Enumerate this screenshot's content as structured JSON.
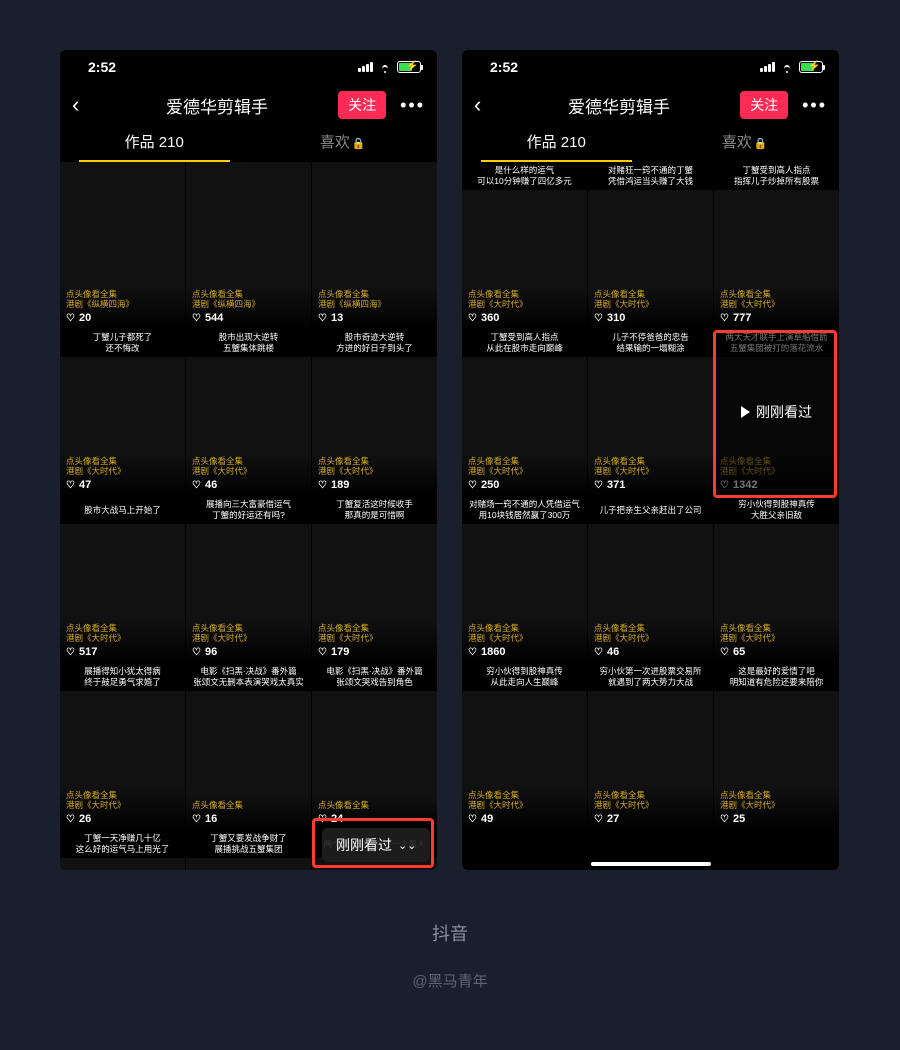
{
  "status_bar": {
    "time": "2:52"
  },
  "nav": {
    "title": "爱德华剪辑手",
    "follow_label": "关注",
    "more_label": "•••"
  },
  "tabs": {
    "works_label": "作品 210",
    "likes_label": "喜欢"
  },
  "just_watched": {
    "pill_label": "刚刚看过",
    "overlay_label": "刚刚看过"
  },
  "phone_left": {
    "cells": [
      {
        "title_l1": "",
        "title_l2": "",
        "series_l1": "点头像看全集",
        "series_l2": "港剧《纵横四海》",
        "likes": "20"
      },
      {
        "title_l1": "",
        "title_l2": "",
        "series_l1": "点头像看全集",
        "series_l2": "港剧《纵横四海》",
        "likes": "544"
      },
      {
        "title_l1": "",
        "title_l2": "",
        "series_l1": "点头像看全集",
        "series_l2": "港剧《纵横四海》",
        "likes": "13"
      },
      {
        "title_l1": "丁蟹儿子都死了",
        "title_l2": "还不悔改",
        "series_l1": "点头像看全集",
        "series_l2": "港剧《大时代》",
        "likes": "47"
      },
      {
        "title_l1": "股市出现大逆转",
        "title_l2": "五蟹集体跳楼",
        "series_l1": "点头像看全集",
        "series_l2": "港剧《大时代》",
        "likes": "46"
      },
      {
        "title_l1": "股市奇迹大逆转",
        "title_l2": "方进的好日子到头了",
        "series_l1": "点头像看全集",
        "series_l2": "港剧《大时代》",
        "likes": "189"
      },
      {
        "title_l1": "股市大战马上开始了",
        "title_l2": "",
        "series_l1": "点头像看全集",
        "series_l2": "港剧《大时代》",
        "likes": "517"
      },
      {
        "title_l1": "展播向三大富豪借运气",
        "title_l2": "丁蟹的好运还有吗?",
        "series_l1": "点头像看全集",
        "series_l2": "港剧《大时代》",
        "likes": "96"
      },
      {
        "title_l1": "丁蟹复活这时候收手",
        "title_l2": "那真的是可惜啊",
        "series_l1": "点头像看全集",
        "series_l2": "港剧《大时代》",
        "likes": "179"
      },
      {
        "title_l1": "展播得知小犹太得病",
        "title_l2": "终于鼓足勇气求婚了",
        "series_l1": "点头像看全集",
        "series_l2": "港剧《大时代》",
        "likes": "26"
      },
      {
        "title_l1": "电影《扫黑·决战》番外篇",
        "title_l2": "张颂文无删本表演哭戏太真实",
        "series_l1": "点头像看全集",
        "series_l2": "",
        "likes": "16"
      },
      {
        "title_l1": "电影《扫黑·决战》番外篇",
        "title_l2": "张颂文哭戏告别角色",
        "series_l1": "点头像看全集",
        "series_l2": "",
        "likes": "24"
      },
      {
        "title_l1": "丁蟹一天净赚几十亿",
        "title_l2": "这么好的运气马上用光了",
        "series_l1": "",
        "series_l2": "",
        "likes": ""
      },
      {
        "title_l1": "丁蟹又要发战争财了",
        "title_l2": "展播挑战五蟹集团",
        "series_l1": "",
        "series_l2": "",
        "likes": ""
      },
      {
        "title_l1": "两个女人同时喜欢一个男人",
        "title_l2": "",
        "series_l1": "",
        "series_l2": "",
        "likes": ""
      }
    ]
  },
  "phone_right": {
    "cells": [
      {
        "title_l1": "是什么样的运气",
        "title_l2": "可以10分钟赚了四亿多元",
        "series_l1": "点头像看全集",
        "series_l2": "港剧《大时代》",
        "likes": "360"
      },
      {
        "title_l1": "对赌狂一窍不通的丁蟹",
        "title_l2": "凭借鸿运当头赚了大钱",
        "series_l1": "点头像看全集",
        "series_l2": "港剧《大时代》",
        "likes": "310"
      },
      {
        "title_l1": "丁蟹受到高人指点",
        "title_l2": "指挥儿子炒掉所有股票",
        "series_l1": "点头像看全集",
        "series_l2": "港剧《大时代》",
        "likes": "777"
      },
      {
        "title_l1": "丁蟹受到高人指点",
        "title_l2": "从此在股市走向巅峰",
        "series_l1": "点头像看全集",
        "series_l2": "港剧《大时代》",
        "likes": "250"
      },
      {
        "title_l1": "儿子不停爸爸的忠告",
        "title_l2": "结果输的一塌糊涂",
        "series_l1": "点头像看全集",
        "series_l2": "港剧《大时代》",
        "likes": "371"
      },
      {
        "title_l1": "两大天才联手上演草船借箭",
        "title_l2": "五蟹集团被打的落花流水",
        "series_l1": "点头像看全集",
        "series_l2": "港剧《大时代》",
        "likes": "1342"
      },
      {
        "title_l1": "对赌场一窍不通的人凭借运气",
        "title_l2": "用10块钱居然赢了300万",
        "series_l1": "点头像看全集",
        "series_l2": "港剧《大时代》",
        "likes": "1860"
      },
      {
        "title_l1": "儿子把亲生父亲赶出了公司",
        "title_l2": "",
        "series_l1": "点头像看全集",
        "series_l2": "港剧《大时代》",
        "likes": "46"
      },
      {
        "title_l1": "穷小伙得到股神真传",
        "title_l2": "大胜父亲旧敌",
        "series_l1": "点头像看全集",
        "series_l2": "港剧《大时代》",
        "likes": "65"
      },
      {
        "title_l1": "穷小伙得到股神真传",
        "title_l2": "从此走向人生巅峰",
        "series_l1": "点头像看全集",
        "series_l2": "港剧《大时代》",
        "likes": "49"
      },
      {
        "title_l1": "穷小伙第一次进股票交易所",
        "title_l2": "就遇到了两大势力大战",
        "series_l1": "点头像看全集",
        "series_l2": "港剧《大时代》",
        "likes": "27"
      },
      {
        "title_l1": "这是最好的爱情了吧",
        "title_l2": "明知道有危险还要来陪你",
        "series_l1": "点头像看全集",
        "series_l2": "港剧《大时代》",
        "likes": "25"
      }
    ]
  },
  "caption": {
    "main": "抖音",
    "sub": "@黑马青年"
  }
}
